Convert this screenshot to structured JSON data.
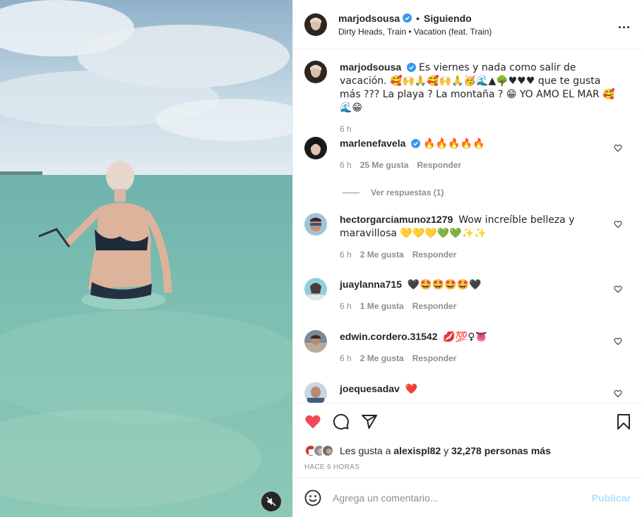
{
  "header": {
    "username": "marjodsousa",
    "separator": "•",
    "follow_status": "Siguiendo",
    "audio": "Dirty Heads, Train • Vacation (feat. Train)",
    "more": "..."
  },
  "caption": {
    "username": "marjodsousa",
    "text": "Es viernes y nada como salir de vacación. 🥰🙌🙏🥰🙌🙏🥳🌊▲🌳♥♥♥ que te gusta más ??? La playa ? La montaña ? 😁 YO AMO EL MAR 🥰🌊😁",
    "time": "6 h"
  },
  "comments": [
    {
      "username": "marlenefavela",
      "verified": true,
      "text": "🔥🔥🔥🔥🔥",
      "time": "6 h",
      "likes": "25 Me gusta",
      "reply": "Responder"
    },
    {
      "username": "hectorgarciamunoz1279",
      "verified": false,
      "text": "Wow increíble belleza y maravillosa 💛💛💛💚💚✨✨",
      "time": "6 h",
      "likes": "2 Me gusta",
      "reply": "Responder"
    },
    {
      "username": "juaylanna715",
      "verified": false,
      "text": "🖤🤩🤩🤩🤩🖤",
      "time": "6 h",
      "likes": "1 Me gusta",
      "reply": "Responder"
    },
    {
      "username": "edwin.cordero.31542",
      "verified": false,
      "text": "💋💯♀👅",
      "time": "6 h",
      "likes": "2 Me gusta",
      "reply": "Responder"
    },
    {
      "username": "joequesadav",
      "verified": false,
      "text": "❤️",
      "time": "",
      "likes": "",
      "reply": ""
    }
  ],
  "replies_link": "Ver respuestas (1)",
  "likes": {
    "prefix": "Les gusta a",
    "user": "alexispl82",
    "middle": "y",
    "count": "32,278 personas más"
  },
  "time_ago": "HACE 6 HORAS",
  "add_comment": {
    "placeholder": "Agrega un comentario...",
    "publish": "Publicar"
  },
  "colors": {
    "like_red": "#ed4956",
    "verified_blue": "#3897f0",
    "publish_disabled": "#b2dffc"
  },
  "icons": [
    "heart-filled-icon",
    "comment-icon",
    "share-icon",
    "bookmark-icon",
    "mute-icon",
    "emoji-icon",
    "verified-icon",
    "more-icon"
  ]
}
